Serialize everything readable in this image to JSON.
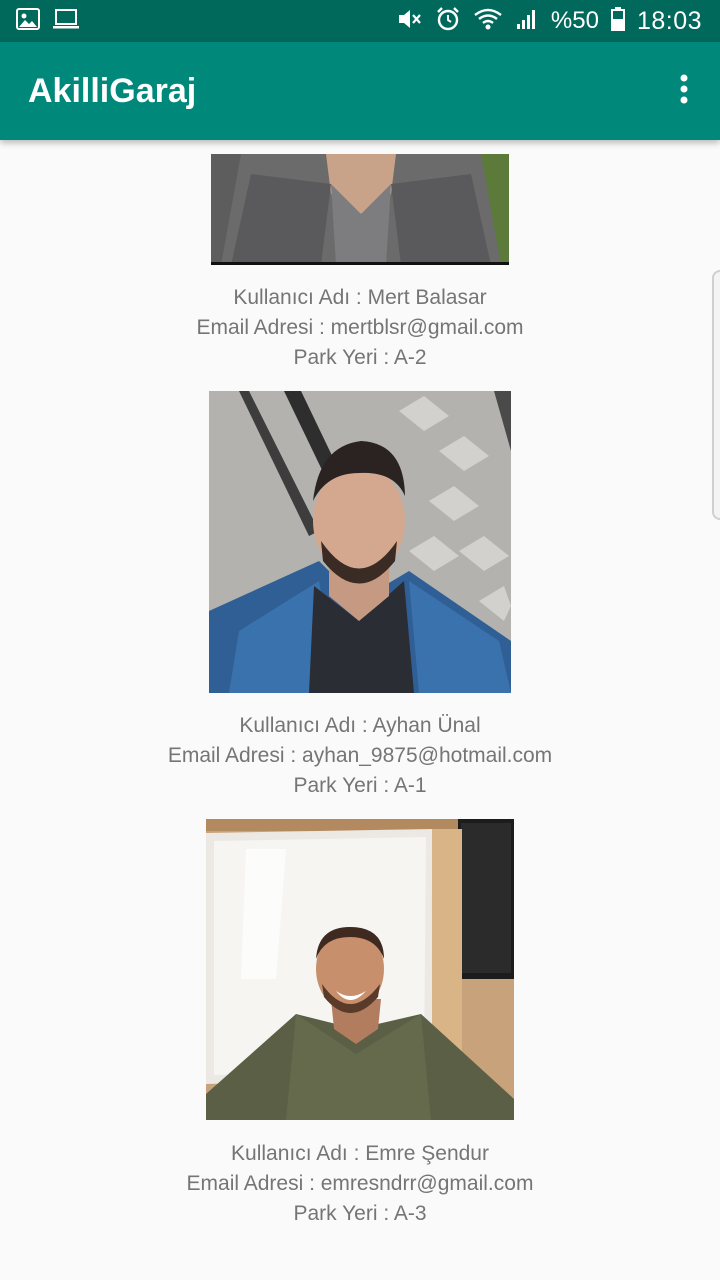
{
  "status_bar": {
    "left_icons": [
      "gallery-icon",
      "laptop-icon"
    ],
    "right_icons": [
      "mute-icon",
      "alarm-icon",
      "wifi-icon",
      "signal-icon",
      "battery-icon"
    ],
    "battery_percent": "%50",
    "time": "18:03"
  },
  "app_bar": {
    "title": "AkilliGaraj",
    "menu_icon": "overflow-menu-icon"
  },
  "users": [
    {
      "username_line": "Kullanıcı Adı : Mert Balasar",
      "email_line": "Email Adresi : mertblsr@gmail.com",
      "park_line": "Park Yeri : A-2"
    },
    {
      "username_line": "Kullanıcı Adı : Ayhan Ünal",
      "email_line": "Email Adresi : ayhan_9875@hotmail.com",
      "park_line": "Park Yeri : A-1"
    },
    {
      "username_line": "Kullanıcı Adı : Emre Şendur",
      "email_line": "Email Adresi : emresndrr@gmail.com",
      "park_line": "Park Yeri : A-3"
    }
  ]
}
